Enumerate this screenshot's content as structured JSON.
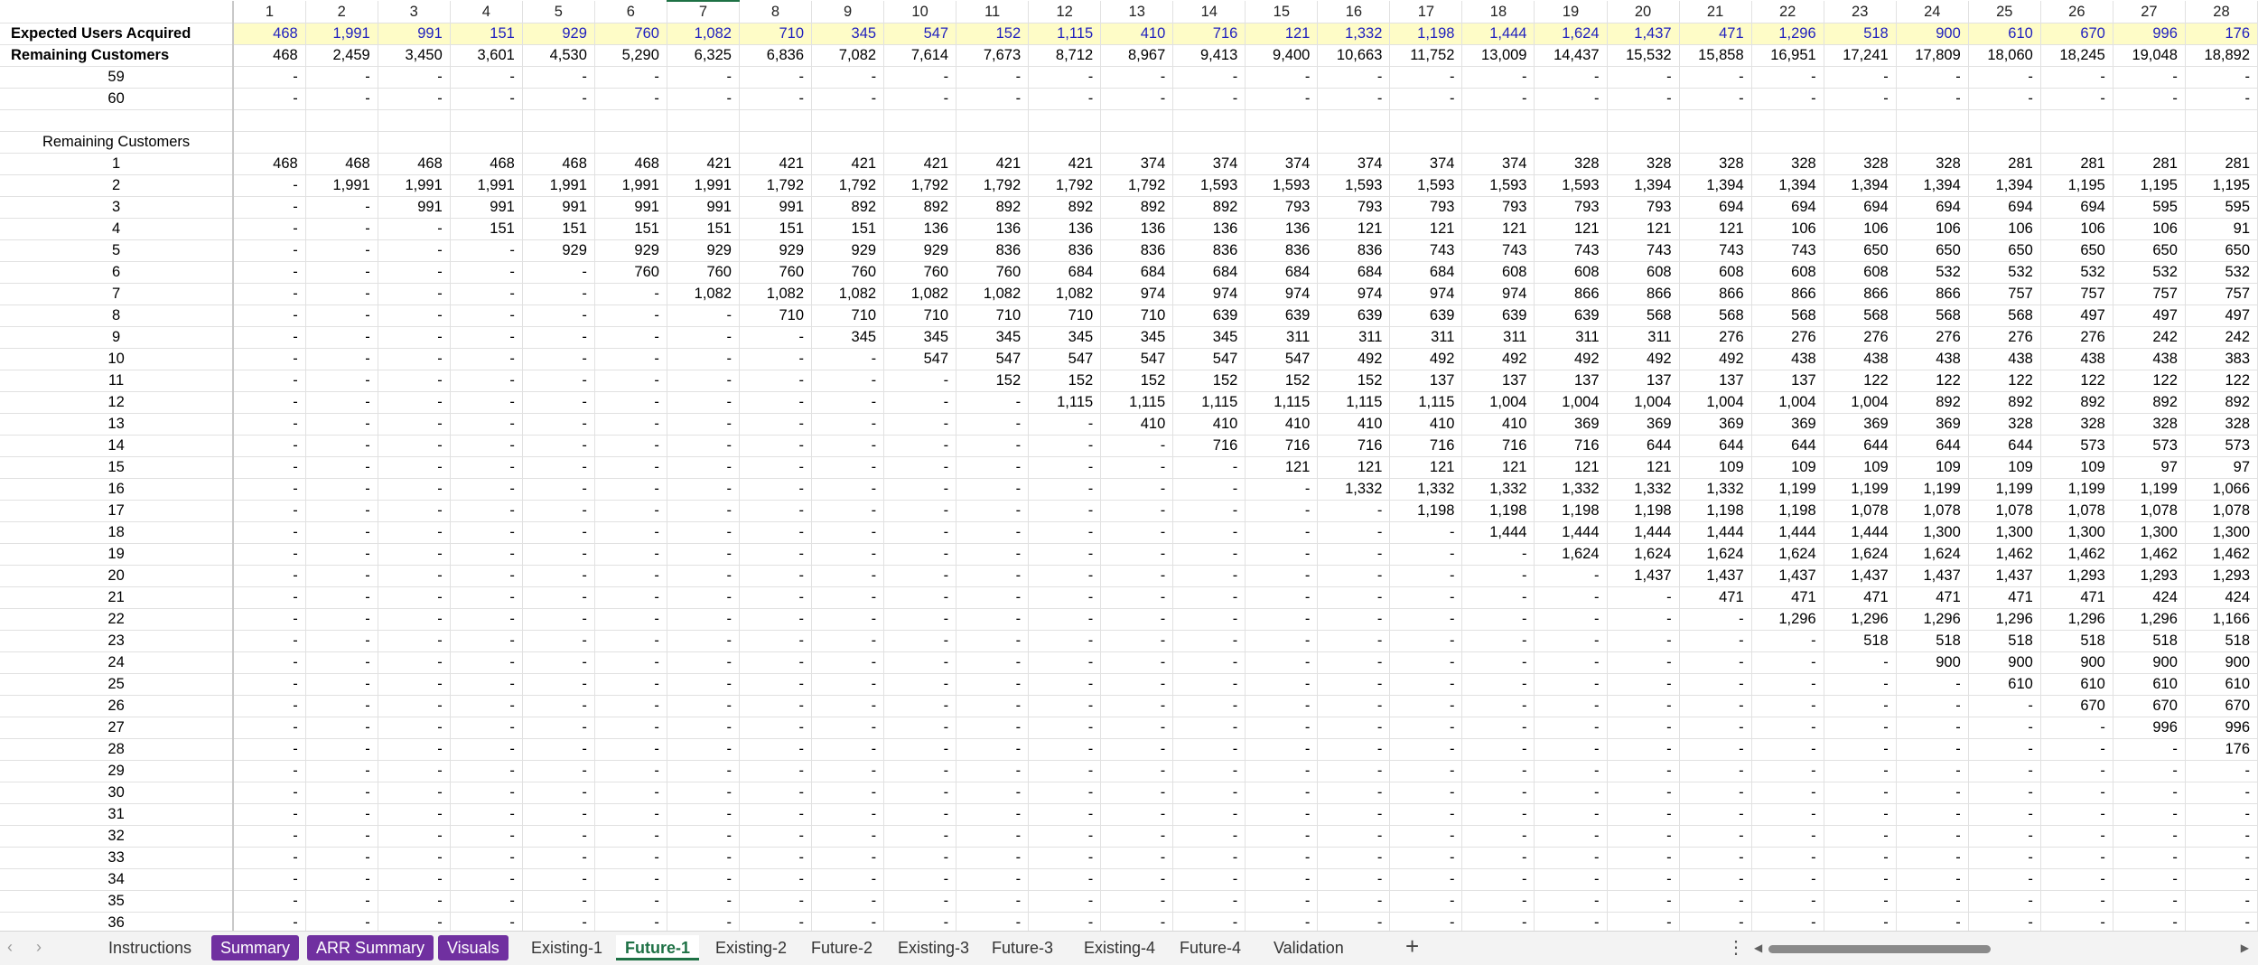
{
  "columns": [
    "1",
    "2",
    "3",
    "4",
    "5",
    "6",
    "7",
    "8",
    "9",
    "10",
    "11",
    "12",
    "13",
    "14",
    "15",
    "16",
    "17",
    "18",
    "19",
    "20",
    "21",
    "22",
    "23",
    "24",
    "25",
    "26",
    "27",
    "28"
  ],
  "selected_column": "7",
  "top_rows": [
    {
      "label": "Expected Users Acquired",
      "kind": "input",
      "values": [
        "468",
        "1,991",
        "991",
        "151",
        "929",
        "760",
        "1,082",
        "710",
        "345",
        "547",
        "152",
        "1,115",
        "410",
        "716",
        "121",
        "1,332",
        "1,198",
        "1,444",
        "1,624",
        "1,437",
        "471",
        "1,296",
        "518",
        "900",
        "610",
        "670",
        "996",
        "176"
      ]
    },
    {
      "label": "Remaining Customers",
      "kind": "rem",
      "values": [
        "468",
        "2,459",
        "3,450",
        "3,601",
        "4,530",
        "5,290",
        "6,325",
        "6,836",
        "7,082",
        "7,614",
        "7,673",
        "8,712",
        "8,967",
        "9,413",
        "9,400",
        "10,663",
        "11,752",
        "13,009",
        "14,437",
        "15,532",
        "15,858",
        "16,951",
        "17,241",
        "17,809",
        "18,060",
        "18,245",
        "19,048",
        "18,892"
      ]
    }
  ],
  "pre_rows": [
    {
      "label": "59",
      "values": [
        "-",
        "-",
        "-",
        "-",
        "-",
        "-",
        "-",
        "-",
        "-",
        "-",
        "-",
        "-",
        "-",
        "-",
        "-",
        "-",
        "-",
        "-",
        "-",
        "-",
        "-",
        "-",
        "-",
        "-",
        "-",
        "-",
        "-",
        "-"
      ]
    },
    {
      "label": "60",
      "values": [
        "-",
        "-",
        "-",
        "-",
        "-",
        "-",
        "-",
        "-",
        "-",
        "-",
        "-",
        "-",
        "-",
        "-",
        "-",
        "-",
        "-",
        "-",
        "-",
        "-",
        "-",
        "-",
        "-",
        "-",
        "-",
        "-",
        "-",
        "-"
      ]
    }
  ],
  "section_label": "Remaining Customers",
  "cohort_rows": [
    {
      "label": "1",
      "values": [
        "468",
        "468",
        "468",
        "468",
        "468",
        "468",
        "421",
        "421",
        "421",
        "421",
        "421",
        "421",
        "374",
        "374",
        "374",
        "374",
        "374",
        "374",
        "328",
        "328",
        "328",
        "328",
        "328",
        "328",
        "281",
        "281",
        "281",
        "281"
      ]
    },
    {
      "label": "2",
      "values": [
        "-",
        "1,991",
        "1,991",
        "1,991",
        "1,991",
        "1,991",
        "1,991",
        "1,792",
        "1,792",
        "1,792",
        "1,792",
        "1,792",
        "1,792",
        "1,593",
        "1,593",
        "1,593",
        "1,593",
        "1,593",
        "1,593",
        "1,394",
        "1,394",
        "1,394",
        "1,394",
        "1,394",
        "1,394",
        "1,195",
        "1,195",
        "1,195"
      ]
    },
    {
      "label": "3",
      "values": [
        "-",
        "-",
        "991",
        "991",
        "991",
        "991",
        "991",
        "991",
        "892",
        "892",
        "892",
        "892",
        "892",
        "892",
        "793",
        "793",
        "793",
        "793",
        "793",
        "793",
        "694",
        "694",
        "694",
        "694",
        "694",
        "694",
        "595",
        "595"
      ]
    },
    {
      "label": "4",
      "values": [
        "-",
        "-",
        "-",
        "151",
        "151",
        "151",
        "151",
        "151",
        "151",
        "136",
        "136",
        "136",
        "136",
        "136",
        "136",
        "121",
        "121",
        "121",
        "121",
        "121",
        "121",
        "106",
        "106",
        "106",
        "106",
        "106",
        "106",
        "91"
      ]
    },
    {
      "label": "5",
      "values": [
        "-",
        "-",
        "-",
        "-",
        "929",
        "929",
        "929",
        "929",
        "929",
        "929",
        "836",
        "836",
        "836",
        "836",
        "836",
        "836",
        "743",
        "743",
        "743",
        "743",
        "743",
        "743",
        "650",
        "650",
        "650",
        "650",
        "650",
        "650"
      ]
    },
    {
      "label": "6",
      "values": [
        "-",
        "-",
        "-",
        "-",
        "-",
        "760",
        "760",
        "760",
        "760",
        "760",
        "760",
        "684",
        "684",
        "684",
        "684",
        "684",
        "684",
        "608",
        "608",
        "608",
        "608",
        "608",
        "608",
        "532",
        "532",
        "532",
        "532",
        "532"
      ]
    },
    {
      "label": "7",
      "values": [
        "-",
        "-",
        "-",
        "-",
        "-",
        "-",
        "1,082",
        "1,082",
        "1,082",
        "1,082",
        "1,082",
        "1,082",
        "974",
        "974",
        "974",
        "974",
        "974",
        "974",
        "866",
        "866",
        "866",
        "866",
        "866",
        "866",
        "757",
        "757",
        "757",
        "757"
      ]
    },
    {
      "label": "8",
      "values": [
        "-",
        "-",
        "-",
        "-",
        "-",
        "-",
        "-",
        "710",
        "710",
        "710",
        "710",
        "710",
        "710",
        "639",
        "639",
        "639",
        "639",
        "639",
        "639",
        "568",
        "568",
        "568",
        "568",
        "568",
        "568",
        "497",
        "497",
        "497"
      ]
    },
    {
      "label": "9",
      "values": [
        "-",
        "-",
        "-",
        "-",
        "-",
        "-",
        "-",
        "-",
        "345",
        "345",
        "345",
        "345",
        "345",
        "345",
        "311",
        "311",
        "311",
        "311",
        "311",
        "311",
        "276",
        "276",
        "276",
        "276",
        "276",
        "276",
        "242",
        "242"
      ]
    },
    {
      "label": "10",
      "values": [
        "-",
        "-",
        "-",
        "-",
        "-",
        "-",
        "-",
        "-",
        "-",
        "547",
        "547",
        "547",
        "547",
        "547",
        "547",
        "492",
        "492",
        "492",
        "492",
        "492",
        "492",
        "438",
        "438",
        "438",
        "438",
        "438",
        "438",
        "383"
      ]
    },
    {
      "label": "11",
      "values": [
        "-",
        "-",
        "-",
        "-",
        "-",
        "-",
        "-",
        "-",
        "-",
        "-",
        "152",
        "152",
        "152",
        "152",
        "152",
        "152",
        "137",
        "137",
        "137",
        "137",
        "137",
        "137",
        "122",
        "122",
        "122",
        "122",
        "122",
        "122"
      ]
    },
    {
      "label": "12",
      "values": [
        "-",
        "-",
        "-",
        "-",
        "-",
        "-",
        "-",
        "-",
        "-",
        "-",
        "-",
        "1,115",
        "1,115",
        "1,115",
        "1,115",
        "1,115",
        "1,115",
        "1,004",
        "1,004",
        "1,004",
        "1,004",
        "1,004",
        "1,004",
        "892",
        "892",
        "892",
        "892",
        "892"
      ]
    },
    {
      "label": "13",
      "values": [
        "-",
        "-",
        "-",
        "-",
        "-",
        "-",
        "-",
        "-",
        "-",
        "-",
        "-",
        "-",
        "410",
        "410",
        "410",
        "410",
        "410",
        "410",
        "369",
        "369",
        "369",
        "369",
        "369",
        "369",
        "328",
        "328",
        "328",
        "328"
      ]
    },
    {
      "label": "14",
      "values": [
        "-",
        "-",
        "-",
        "-",
        "-",
        "-",
        "-",
        "-",
        "-",
        "-",
        "-",
        "-",
        "-",
        "716",
        "716",
        "716",
        "716",
        "716",
        "716",
        "644",
        "644",
        "644",
        "644",
        "644",
        "644",
        "573",
        "573",
        "573"
      ]
    },
    {
      "label": "15",
      "values": [
        "-",
        "-",
        "-",
        "-",
        "-",
        "-",
        "-",
        "-",
        "-",
        "-",
        "-",
        "-",
        "-",
        "-",
        "121",
        "121",
        "121",
        "121",
        "121",
        "121",
        "109",
        "109",
        "109",
        "109",
        "109",
        "109",
        "97",
        "97"
      ]
    },
    {
      "label": "16",
      "values": [
        "-",
        "-",
        "-",
        "-",
        "-",
        "-",
        "-",
        "-",
        "-",
        "-",
        "-",
        "-",
        "-",
        "-",
        "-",
        "1,332",
        "1,332",
        "1,332",
        "1,332",
        "1,332",
        "1,332",
        "1,199",
        "1,199",
        "1,199",
        "1,199",
        "1,199",
        "1,199",
        "1,066"
      ]
    },
    {
      "label": "17",
      "values": [
        "-",
        "-",
        "-",
        "-",
        "-",
        "-",
        "-",
        "-",
        "-",
        "-",
        "-",
        "-",
        "-",
        "-",
        "-",
        "-",
        "1,198",
        "1,198",
        "1,198",
        "1,198",
        "1,198",
        "1,198",
        "1,078",
        "1,078",
        "1,078",
        "1,078",
        "1,078",
        "1,078"
      ]
    },
    {
      "label": "18",
      "values": [
        "-",
        "-",
        "-",
        "-",
        "-",
        "-",
        "-",
        "-",
        "-",
        "-",
        "-",
        "-",
        "-",
        "-",
        "-",
        "-",
        "-",
        "1,444",
        "1,444",
        "1,444",
        "1,444",
        "1,444",
        "1,444",
        "1,300",
        "1,300",
        "1,300",
        "1,300",
        "1,300"
      ]
    },
    {
      "label": "19",
      "values": [
        "-",
        "-",
        "-",
        "-",
        "-",
        "-",
        "-",
        "-",
        "-",
        "-",
        "-",
        "-",
        "-",
        "-",
        "-",
        "-",
        "-",
        "-",
        "1,624",
        "1,624",
        "1,624",
        "1,624",
        "1,624",
        "1,624",
        "1,462",
        "1,462",
        "1,462",
        "1,462"
      ]
    },
    {
      "label": "20",
      "values": [
        "-",
        "-",
        "-",
        "-",
        "-",
        "-",
        "-",
        "-",
        "-",
        "-",
        "-",
        "-",
        "-",
        "-",
        "-",
        "-",
        "-",
        "-",
        "-",
        "1,437",
        "1,437",
        "1,437",
        "1,437",
        "1,437",
        "1,437",
        "1,293",
        "1,293",
        "1,293"
      ]
    },
    {
      "label": "21",
      "values": [
        "-",
        "-",
        "-",
        "-",
        "-",
        "-",
        "-",
        "-",
        "-",
        "-",
        "-",
        "-",
        "-",
        "-",
        "-",
        "-",
        "-",
        "-",
        "-",
        "-",
        "471",
        "471",
        "471",
        "471",
        "471",
        "471",
        "424",
        "424"
      ]
    },
    {
      "label": "22",
      "values": [
        "-",
        "-",
        "-",
        "-",
        "-",
        "-",
        "-",
        "-",
        "-",
        "-",
        "-",
        "-",
        "-",
        "-",
        "-",
        "-",
        "-",
        "-",
        "-",
        "-",
        "-",
        "1,296",
        "1,296",
        "1,296",
        "1,296",
        "1,296",
        "1,296",
        "1,166"
      ]
    },
    {
      "label": "23",
      "values": [
        "-",
        "-",
        "-",
        "-",
        "-",
        "-",
        "-",
        "-",
        "-",
        "-",
        "-",
        "-",
        "-",
        "-",
        "-",
        "-",
        "-",
        "-",
        "-",
        "-",
        "-",
        "-",
        "518",
        "518",
        "518",
        "518",
        "518",
        "518"
      ]
    },
    {
      "label": "24",
      "values": [
        "-",
        "-",
        "-",
        "-",
        "-",
        "-",
        "-",
        "-",
        "-",
        "-",
        "-",
        "-",
        "-",
        "-",
        "-",
        "-",
        "-",
        "-",
        "-",
        "-",
        "-",
        "-",
        "-",
        "900",
        "900",
        "900",
        "900",
        "900"
      ]
    },
    {
      "label": "25",
      "values": [
        "-",
        "-",
        "-",
        "-",
        "-",
        "-",
        "-",
        "-",
        "-",
        "-",
        "-",
        "-",
        "-",
        "-",
        "-",
        "-",
        "-",
        "-",
        "-",
        "-",
        "-",
        "-",
        "-",
        "-",
        "610",
        "610",
        "610",
        "610"
      ]
    },
    {
      "label": "26",
      "values": [
        "-",
        "-",
        "-",
        "-",
        "-",
        "-",
        "-",
        "-",
        "-",
        "-",
        "-",
        "-",
        "-",
        "-",
        "-",
        "-",
        "-",
        "-",
        "-",
        "-",
        "-",
        "-",
        "-",
        "-",
        "-",
        "670",
        "670",
        "670"
      ]
    },
    {
      "label": "27",
      "values": [
        "-",
        "-",
        "-",
        "-",
        "-",
        "-",
        "-",
        "-",
        "-",
        "-",
        "-",
        "-",
        "-",
        "-",
        "-",
        "-",
        "-",
        "-",
        "-",
        "-",
        "-",
        "-",
        "-",
        "-",
        "-",
        "-",
        "996",
        "996"
      ]
    },
    {
      "label": "28",
      "values": [
        "-",
        "-",
        "-",
        "-",
        "-",
        "-",
        "-",
        "-",
        "-",
        "-",
        "-",
        "-",
        "-",
        "-",
        "-",
        "-",
        "-",
        "-",
        "-",
        "-",
        "-",
        "-",
        "-",
        "-",
        "-",
        "-",
        "-",
        "176"
      ]
    },
    {
      "label": "29",
      "values": [
        "-",
        "-",
        "-",
        "-",
        "-",
        "-",
        "-",
        "-",
        "-",
        "-",
        "-",
        "-",
        "-",
        "-",
        "-",
        "-",
        "-",
        "-",
        "-",
        "-",
        "-",
        "-",
        "-",
        "-",
        "-",
        "-",
        "-",
        "-"
      ]
    },
    {
      "label": "30",
      "values": [
        "-",
        "-",
        "-",
        "-",
        "-",
        "-",
        "-",
        "-",
        "-",
        "-",
        "-",
        "-",
        "-",
        "-",
        "-",
        "-",
        "-",
        "-",
        "-",
        "-",
        "-",
        "-",
        "-",
        "-",
        "-",
        "-",
        "-",
        "-"
      ]
    },
    {
      "label": "31",
      "values": [
        "-",
        "-",
        "-",
        "-",
        "-",
        "-",
        "-",
        "-",
        "-",
        "-",
        "-",
        "-",
        "-",
        "-",
        "-",
        "-",
        "-",
        "-",
        "-",
        "-",
        "-",
        "-",
        "-",
        "-",
        "-",
        "-",
        "-",
        "-"
      ]
    },
    {
      "label": "32",
      "values": [
        "-",
        "-",
        "-",
        "-",
        "-",
        "-",
        "-",
        "-",
        "-",
        "-",
        "-",
        "-",
        "-",
        "-",
        "-",
        "-",
        "-",
        "-",
        "-",
        "-",
        "-",
        "-",
        "-",
        "-",
        "-",
        "-",
        "-",
        "-"
      ]
    },
    {
      "label": "33",
      "values": [
        "-",
        "-",
        "-",
        "-",
        "-",
        "-",
        "-",
        "-",
        "-",
        "-",
        "-",
        "-",
        "-",
        "-",
        "-",
        "-",
        "-",
        "-",
        "-",
        "-",
        "-",
        "-",
        "-",
        "-",
        "-",
        "-",
        "-",
        "-"
      ]
    },
    {
      "label": "34",
      "values": [
        "-",
        "-",
        "-",
        "-",
        "-",
        "-",
        "-",
        "-",
        "-",
        "-",
        "-",
        "-",
        "-",
        "-",
        "-",
        "-",
        "-",
        "-",
        "-",
        "-",
        "-",
        "-",
        "-",
        "-",
        "-",
        "-",
        "-",
        "-"
      ]
    },
    {
      "label": "35",
      "values": [
        "-",
        "-",
        "-",
        "-",
        "-",
        "-",
        "-",
        "-",
        "-",
        "-",
        "-",
        "-",
        "-",
        "-",
        "-",
        "-",
        "-",
        "-",
        "-",
        "-",
        "-",
        "-",
        "-",
        "-",
        "-",
        "-",
        "-",
        "-"
      ]
    },
    {
      "label": "36",
      "values": [
        "-",
        "-",
        "-",
        "-",
        "-",
        "-",
        "-",
        "-",
        "-",
        "-",
        "-",
        "-",
        "-",
        "-",
        "-",
        "-",
        "-",
        "-",
        "-",
        "-",
        "-",
        "-",
        "-",
        "-",
        "-",
        "-",
        "-",
        "-"
      ]
    }
  ],
  "tabs": [
    {
      "label": "Instructions",
      "style": "plain"
    },
    {
      "label": "Summary",
      "style": "colored"
    },
    {
      "label": "ARR Summary",
      "style": "colored"
    },
    {
      "label": "Visuals",
      "style": "colored"
    },
    {
      "label": "Existing-1",
      "style": "plain"
    },
    {
      "label": "Future-1",
      "style": "active"
    },
    {
      "label": "Existing-2",
      "style": "plain"
    },
    {
      "label": "Future-2",
      "style": "plain"
    },
    {
      "label": "Existing-3",
      "style": "plain"
    },
    {
      "label": "Future-3",
      "style": "plain"
    },
    {
      "label": "Existing-4",
      "style": "plain"
    },
    {
      "label": "Future-4",
      "style": "plain"
    },
    {
      "label": "Validation",
      "style": "plain"
    }
  ],
  "add_sheet_label": "+",
  "more_label": "⋮",
  "nav_prev": "‹",
  "nav_next": "›",
  "colors": {
    "input_bg": "#fefcc7",
    "input_text": "#1f1fbf",
    "tab_purple": "#7030a0",
    "active_green": "#1e7145"
  }
}
